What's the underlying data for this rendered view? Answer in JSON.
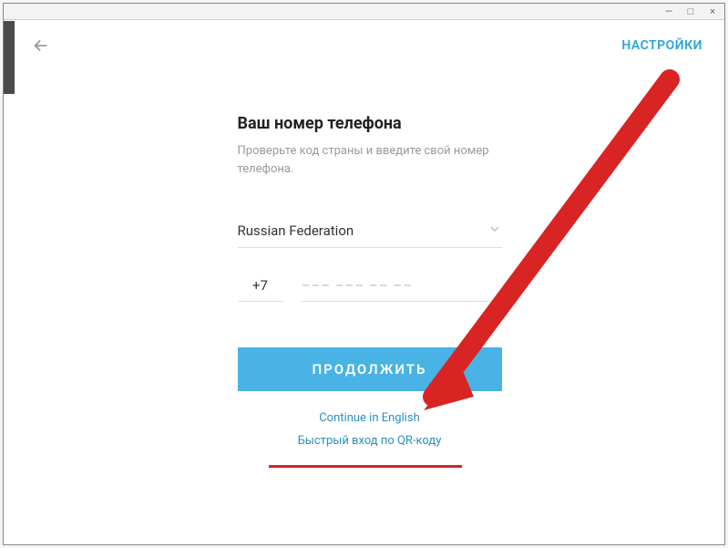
{
  "windowControls": {
    "minimize": "—",
    "maximize": "□",
    "close": "×"
  },
  "header": {
    "settingsLabel": "НАСТРОЙКИ"
  },
  "form": {
    "title": "Ваш номер телефона",
    "subtitle": "Проверьте код страны и введите свой номер телефона.",
    "country": "Russian Federation",
    "code": "+7",
    "phonePlaceholder": "––– ––– –– ––",
    "continueLabel": "ПРОДОЛЖИТЬ",
    "englishLink": "Continue in English",
    "qrLink": "Быстрый вход по QR-коду"
  },
  "annotation": {
    "arrowColor": "#d92424"
  }
}
